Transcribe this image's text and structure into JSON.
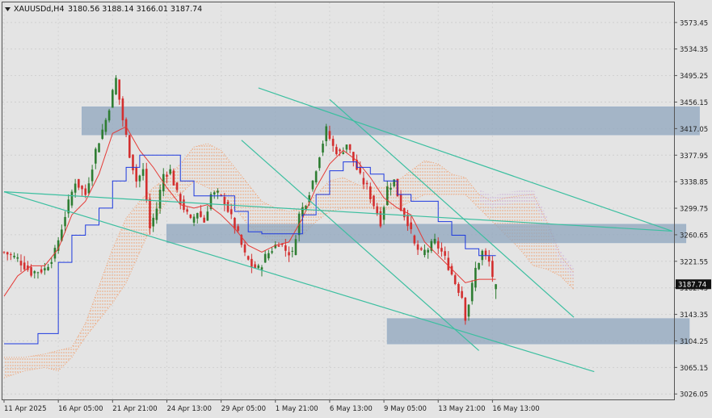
{
  "header": {
    "symbol": "XAUUSDd,H4",
    "ohlc": "3180.56 3188.14 3166.01 3187.74"
  },
  "chart_data": {
    "type": "candlestick",
    "symbol": "XAUUSDd",
    "timeframe": "H4",
    "open": 3180.56,
    "high": 3188.14,
    "low": 3166.01,
    "close": 3187.74,
    "current_price_label": "3187.74",
    "ylim": [
      3018,
      3603
    ],
    "y_ticks": [
      3573.45,
      3534.35,
      3495.25,
      3456.15,
      3417.05,
      3377.95,
      3338.85,
      3299.75,
      3260.65,
      3221.55,
      3182.45,
      3143.35,
      3104.25,
      3065.15,
      3026.05
    ],
    "y_tick_labels": [
      "3573.45",
      "3534.35",
      "3495.25",
      "3456.15",
      "3417.05",
      "3377.95",
      "3338.85",
      "3299.75",
      "3260.65",
      "3221.55",
      "3182.45",
      "3143.35",
      "3104.25",
      "3065.15",
      "3026.05"
    ],
    "x_tick_labels": [
      "11 Apr 2025",
      "16 Apr 05:00",
      "21 Apr 21:00",
      "24 Apr 13:00",
      "29 Apr 05:00",
      "1 May 21:00",
      "6 May 13:00",
      "9 May 05:00",
      "13 May 21:00",
      "16 May 13:00"
    ],
    "x_tick_index": [
      0,
      16,
      32,
      48,
      64,
      80,
      96,
      112,
      128,
      144
    ],
    "bars_total": 198,
    "grid": true,
    "colors": {
      "background": "#e4e4e4",
      "bull": "#2e7d32",
      "bear": "#d32f2f",
      "tenkan": "#e53935",
      "kijun": "#1e3adf",
      "cloud": "#f0a070",
      "cloud_alt": "#c8a8d8",
      "zone": "#8fa6bd",
      "trendline": "#3cbfa0"
    },
    "close_path": [
      [
        0,
        3235
      ],
      [
        4,
        3225
      ],
      [
        8,
        3205
      ],
      [
        12,
        3210
      ],
      [
        15,
        3235
      ],
      [
        18,
        3290
      ],
      [
        21,
        3340
      ],
      [
        24,
        3320
      ],
      [
        27,
        3385
      ],
      [
        30,
        3430
      ],
      [
        33,
        3490
      ],
      [
        35,
        3430
      ],
      [
        37,
        3380
      ],
      [
        39,
        3340
      ],
      [
        41,
        3355
      ],
      [
        43,
        3270
      ],
      [
        45,
        3300
      ],
      [
        47,
        3350
      ],
      [
        49,
        3355
      ],
      [
        51,
        3320
      ],
      [
        53,
        3300
      ],
      [
        55,
        3280
      ],
      [
        57,
        3295
      ],
      [
        59,
        3280
      ],
      [
        61,
        3320
      ],
      [
        63,
        3320
      ],
      [
        65,
        3310
      ],
      [
        67,
        3285
      ],
      [
        69,
        3260
      ],
      [
        71,
        3230
      ],
      [
        73,
        3215
      ],
      [
        75,
        3210
      ],
      [
        77,
        3228
      ],
      [
        79,
        3240
      ],
      [
        81,
        3250
      ],
      [
        83,
        3238
      ],
      [
        85,
        3232
      ],
      [
        87,
        3290
      ],
      [
        89,
        3310
      ],
      [
        91,
        3340
      ],
      [
        93,
        3380
      ],
      [
        95,
        3415
      ],
      [
        97,
        3390
      ],
      [
        99,
        3380
      ],
      [
        101,
        3395
      ],
      [
        103,
        3370
      ],
      [
        105,
        3345
      ],
      [
        107,
        3330
      ],
      [
        109,
        3305
      ],
      [
        111,
        3280
      ],
      [
        113,
        3330
      ],
      [
        115,
        3340
      ],
      [
        117,
        3300
      ],
      [
        119,
        3280
      ],
      [
        121,
        3245
      ],
      [
        123,
        3232
      ],
      [
        125,
        3240
      ],
      [
        127,
        3250
      ],
      [
        129,
        3235
      ],
      [
        131,
        3215
      ],
      [
        133,
        3190
      ],
      [
        135,
        3170
      ],
      [
        136,
        3140
      ],
      [
        137,
        3160
      ],
      [
        139,
        3210
      ],
      [
        141,
        3235
      ],
      [
        143,
        3220
      ],
      [
        144,
        3200
      ],
      [
        145,
        3187.74
      ]
    ],
    "tenkan_path": [
      [
        0,
        3170
      ],
      [
        4,
        3200
      ],
      [
        8,
        3215
      ],
      [
        12,
        3215
      ],
      [
        16,
        3240
      ],
      [
        20,
        3290
      ],
      [
        24,
        3310
      ],
      [
        28,
        3350
      ],
      [
        32,
        3410
      ],
      [
        36,
        3420
      ],
      [
        40,
        3385
      ],
      [
        44,
        3360
      ],
      [
        48,
        3330
      ],
      [
        52,
        3305
      ],
      [
        56,
        3300
      ],
      [
        60,
        3305
      ],
      [
        64,
        3290
      ],
      [
        68,
        3270
      ],
      [
        72,
        3245
      ],
      [
        76,
        3235
      ],
      [
        80,
        3245
      ],
      [
        84,
        3250
      ],
      [
        88,
        3285
      ],
      [
        92,
        3330
      ],
      [
        96,
        3365
      ],
      [
        100,
        3385
      ],
      [
        104,
        3370
      ],
      [
        108,
        3345
      ],
      [
        112,
        3315
      ],
      [
        116,
        3300
      ],
      [
        120,
        3290
      ],
      [
        124,
        3250
      ],
      [
        128,
        3230
      ],
      [
        132,
        3210
      ],
      [
        136,
        3190
      ],
      [
        140,
        3195
      ],
      [
        145,
        3195
      ]
    ],
    "kijun_path": [
      [
        0,
        3100
      ],
      [
        8,
        3100
      ],
      [
        10,
        3115
      ],
      [
        16,
        3220
      ],
      [
        20,
        3260
      ],
      [
        24,
        3275
      ],
      [
        28,
        3300
      ],
      [
        32,
        3340
      ],
      [
        36,
        3360
      ],
      [
        40,
        3378
      ],
      [
        44,
        3378
      ],
      [
        48,
        3378
      ],
      [
        52,
        3340
      ],
      [
        56,
        3318
      ],
      [
        60,
        3318
      ],
      [
        64,
        3318
      ],
      [
        68,
        3295
      ],
      [
        72,
        3265
      ],
      [
        76,
        3262
      ],
      [
        80,
        3262
      ],
      [
        84,
        3262
      ],
      [
        88,
        3290
      ],
      [
        92,
        3320
      ],
      [
        96,
        3355
      ],
      [
        100,
        3368
      ],
      [
        104,
        3360
      ],
      [
        108,
        3350
      ],
      [
        112,
        3340
      ],
      [
        116,
        3320
      ],
      [
        120,
        3310
      ],
      [
        124,
        3310
      ],
      [
        128,
        3280
      ],
      [
        132,
        3260
      ],
      [
        136,
        3240
      ],
      [
        140,
        3230
      ],
      [
        145,
        3230
      ]
    ],
    "cloud_path": [
      [
        0,
        3080,
        3050
      ],
      [
        6,
        3080,
        3060
      ],
      [
        12,
        3085,
        3065
      ],
      [
        16,
        3090,
        3060
      ],
      [
        20,
        3095,
        3080
      ],
      [
        24,
        3130,
        3110
      ],
      [
        28,
        3185,
        3135
      ],
      [
        32,
        3240,
        3160
      ],
      [
        36,
        3285,
        3190
      ],
      [
        40,
        3310,
        3235
      ],
      [
        44,
        3330,
        3280
      ],
      [
        48,
        3345,
        3310
      ],
      [
        52,
        3365,
        3320
      ],
      [
        56,
        3390,
        3340
      ],
      [
        60,
        3395,
        3330
      ],
      [
        64,
        3385,
        3320
      ],
      [
        68,
        3360,
        3300
      ],
      [
        72,
        3335,
        3275
      ],
      [
        76,
        3310,
        3260
      ],
      [
        80,
        3300,
        3250
      ],
      [
        84,
        3295,
        3250
      ],
      [
        88,
        3300,
        3260
      ],
      [
        92,
        3320,
        3280
      ],
      [
        96,
        3340,
        3295
      ],
      [
        100,
        3345,
        3300
      ],
      [
        104,
        3335,
        3300
      ],
      [
        108,
        3330,
        3300
      ],
      [
        112,
        3330,
        3298
      ],
      [
        116,
        3340,
        3300
      ],
      [
        120,
        3355,
        3310
      ],
      [
        124,
        3370,
        3320
      ],
      [
        128,
        3365,
        3320
      ],
      [
        132,
        3350,
        3320
      ],
      [
        136,
        3345,
        3320
      ],
      [
        140,
        3320,
        3300
      ],
      [
        144,
        3310,
        3280
      ],
      [
        148,
        3315,
        3260
      ],
      [
        152,
        3318,
        3240
      ],
      [
        156,
        3320,
        3215
      ],
      [
        160,
        3280,
        3210
      ],
      [
        164,
        3230,
        3200
      ],
      [
        168,
        3205,
        3180
      ]
    ],
    "zones": [
      {
        "x0": 23,
        "x1": 205,
        "y_top": 3449,
        "y_bottom": 3408
      },
      {
        "x0": 48,
        "x1": 201,
        "y_top": 3276,
        "y_bottom": 3249
      },
      {
        "x0": 113,
        "x1": 202,
        "y_top": 3137,
        "y_bottom": 3100
      }
    ],
    "trendlines": [
      {
        "x0": 0,
        "y0": 3324,
        "x1": 197,
        "y1": 3266
      },
      {
        "x0": 0,
        "y0": 3324,
        "x1": 174,
        "y1": 3059
      },
      {
        "x0": 75,
        "y0": 3477,
        "x1": 197,
        "y1": 3266
      },
      {
        "x0": 96,
        "y0": 3460,
        "x1": 168,
        "y1": 3139
      },
      {
        "x0": 70,
        "y0": 3400,
        "x1": 140,
        "y1": 3090
      }
    ]
  }
}
